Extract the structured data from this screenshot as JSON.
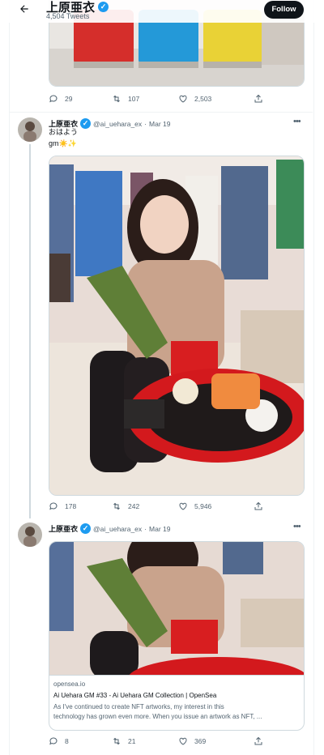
{
  "header": {
    "back_icon": "arrow-left-icon",
    "name": "上原亜衣",
    "tweets_count": "4,504 Tweets",
    "follow_label": "Follow"
  },
  "tweets": [
    {
      "actions": {
        "replies": "29",
        "retweets": "107",
        "likes": "2,503"
      }
    },
    {
      "name": "上原亜衣",
      "handle": "@ai_uehara_ex",
      "dot": "·",
      "date": "Mar 19",
      "text_line1": "おはよう",
      "text_line2": "gm☀️✨",
      "actions": {
        "replies": "178",
        "retweets": "242",
        "likes": "5,946"
      }
    },
    {
      "name": "上原亜衣",
      "handle": "@ai_uehara_ex",
      "dot": "·",
      "date": "Mar 19",
      "card": {
        "domain": "opensea.io",
        "title": "Ai Uehara GM #33 - Ai Uehara GM Collection | OpenSea",
        "description_line1": "As I've continued to create NFT artworks, my interest in this",
        "description_line2": "technology has grown even more. When you issue an artwork as NFT, ..."
      },
      "actions": {
        "replies": "8",
        "retweets": "21",
        "likes": "369"
      }
    }
  ],
  "colors": {
    "accent": "#1d9bf0",
    "text": "#0f1419",
    "muted": "#536471"
  }
}
